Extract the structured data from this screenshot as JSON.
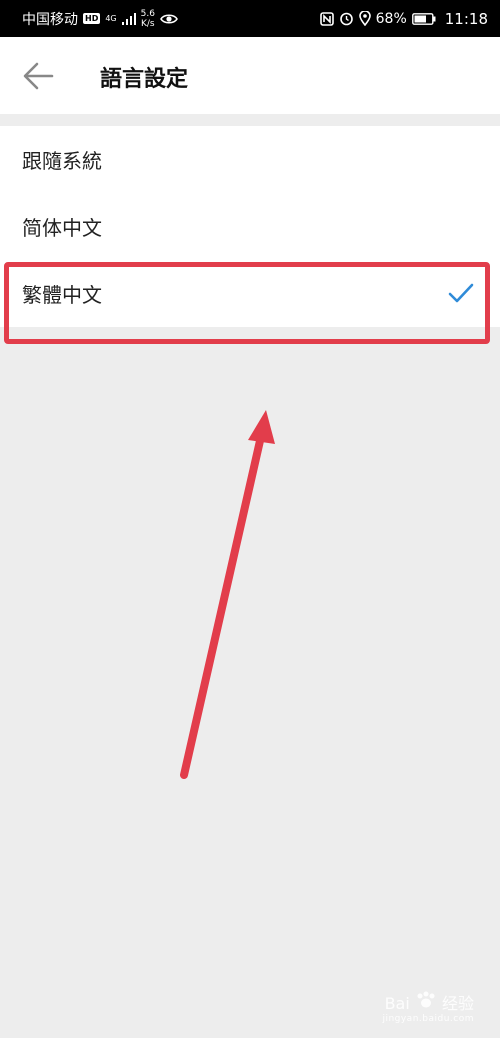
{
  "status_bar": {
    "carrier": "中国移动",
    "hd_badge": "HD",
    "network": "4G",
    "speed_value": "5.6",
    "speed_unit": "K/s",
    "battery_percent": "68%",
    "time": "11:18",
    "icons": [
      "eye-icon",
      "nfc-icon",
      "alarm-icon",
      "location-icon",
      "battery-icon"
    ]
  },
  "header": {
    "title": "語言設定",
    "back_icon": "arrow-left-icon"
  },
  "languages": {
    "items": [
      {
        "label": "跟隨系統",
        "selected": false
      },
      {
        "label": "简体中文",
        "selected": false
      },
      {
        "label": "繁體中文",
        "selected": true
      }
    ],
    "check_color": "#2f8bd8"
  },
  "annotation": {
    "color": "#e23d4b"
  },
  "watermark": {
    "brand": "Bai",
    "suffix": "经验",
    "sub": "jingyan.baidu.com"
  }
}
